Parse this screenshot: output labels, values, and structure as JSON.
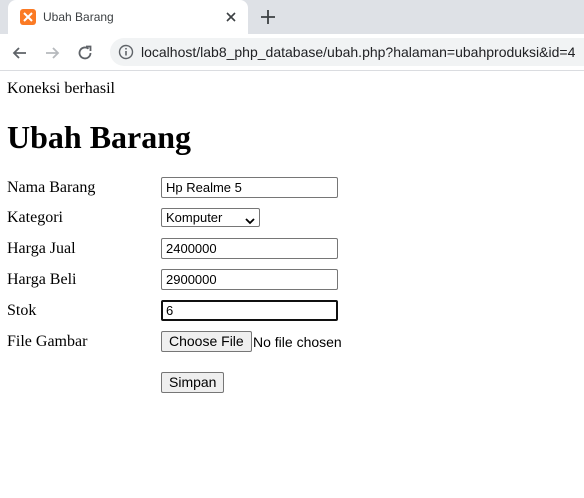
{
  "browser": {
    "tab_title": "Ubah Barang",
    "url": "localhost/lab8_php_database/ubah.php?halaman=ubahproduksi&id=4",
    "icons": [
      "xampp-favicon-icon",
      "close-icon",
      "plus-icon",
      "back-arrow-icon",
      "forward-arrow-icon",
      "reload-icon",
      "info-icon"
    ]
  },
  "page": {
    "status": "Koneksi berhasil",
    "title": "Ubah Barang"
  },
  "form": {
    "nama_label": "Nama Barang",
    "nama_value": "Hp Realme 5",
    "kategori_label": "Kategori",
    "kategori_value": "Komputer",
    "harga_jual_label": "Harga Jual",
    "harga_jual_value": "2400000",
    "harga_beli_label": "Harga Beli",
    "harga_beli_value": "2900000",
    "stok_label": "Stok",
    "stok_value": "6",
    "file_label": "File Gambar",
    "file_button": "Choose File",
    "file_status": "No file chosen",
    "submit_label": "Simpan"
  }
}
